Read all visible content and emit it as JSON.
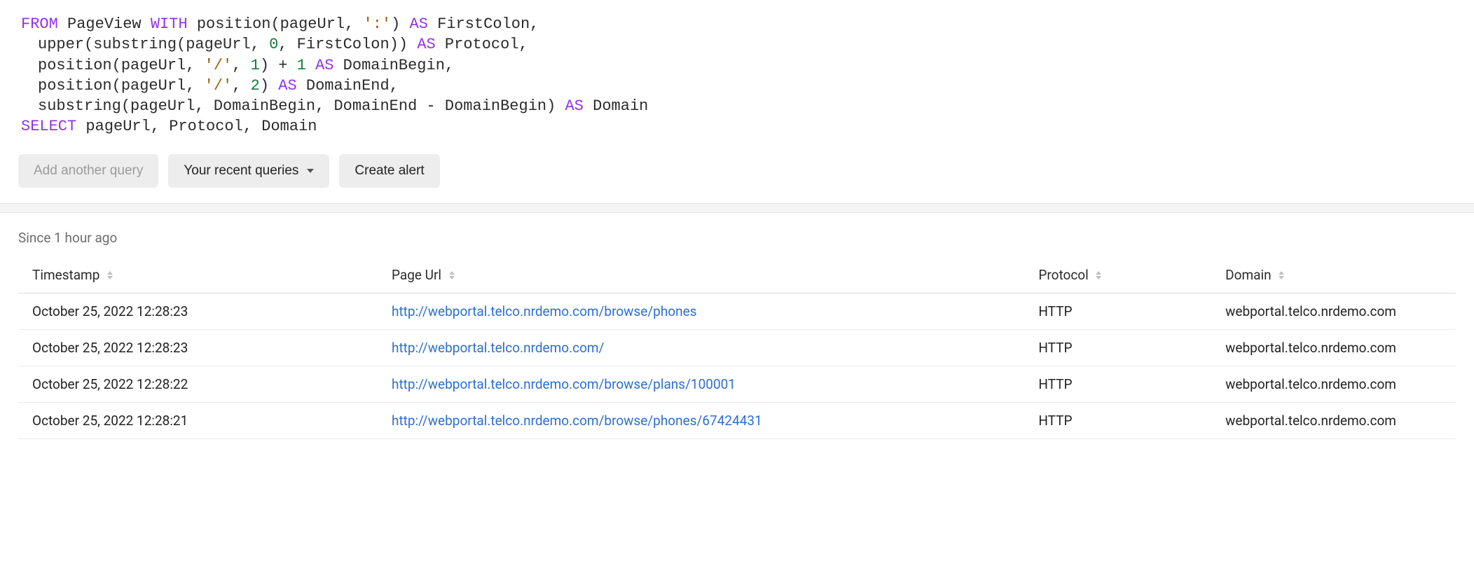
{
  "query": {
    "tokens": [
      [
        {
          "t": "FROM",
          "c": "kw"
        },
        {
          "t": " PageView ",
          "c": ""
        },
        {
          "t": "WITH",
          "c": "kw"
        },
        {
          "t": " position(pageUrl, ",
          "c": ""
        },
        {
          "t": "':'",
          "c": "str"
        },
        {
          "t": ") ",
          "c": ""
        },
        {
          "t": "AS",
          "c": "kw"
        },
        {
          "t": " FirstColon,",
          "c": ""
        }
      ],
      [
        {
          "t": "upper(substring(pageUrl, ",
          "c": ""
        },
        {
          "t": "0",
          "c": "num"
        },
        {
          "t": ", FirstColon)) ",
          "c": ""
        },
        {
          "t": "AS",
          "c": "kw"
        },
        {
          "t": " Protocol,",
          "c": ""
        }
      ],
      [
        {
          "t": "position(pageUrl, ",
          "c": ""
        },
        {
          "t": "'/'",
          "c": "str"
        },
        {
          "t": ", ",
          "c": ""
        },
        {
          "t": "1",
          "c": "num"
        },
        {
          "t": ") + ",
          "c": ""
        },
        {
          "t": "1",
          "c": "num"
        },
        {
          "t": " ",
          "c": ""
        },
        {
          "t": "AS",
          "c": "kw"
        },
        {
          "t": " DomainBegin,",
          "c": ""
        }
      ],
      [
        {
          "t": "position(pageUrl, ",
          "c": ""
        },
        {
          "t": "'/'",
          "c": "str"
        },
        {
          "t": ", ",
          "c": ""
        },
        {
          "t": "2",
          "c": "num"
        },
        {
          "t": ") ",
          "c": ""
        },
        {
          "t": "AS",
          "c": "kw"
        },
        {
          "t": " DomainEnd,",
          "c": ""
        }
      ],
      [
        {
          "t": "substring(pageUrl, DomainBegin, DomainEnd - DomainBegin) ",
          "c": ""
        },
        {
          "t": "AS",
          "c": "kw"
        },
        {
          "t": " Domain",
          "c": ""
        }
      ],
      [
        {
          "t": "SELECT",
          "c": "kw"
        },
        {
          "t": " pageUrl, Protocol, Domain",
          "c": ""
        }
      ]
    ],
    "indented": [
      false,
      true,
      true,
      true,
      true,
      false
    ]
  },
  "buttons": {
    "add_query": "Add another query",
    "recent_queries": "Your recent queries",
    "create_alert": "Create alert"
  },
  "since_label": "Since 1 hour ago",
  "table": {
    "columns": [
      "Timestamp",
      "Page Url",
      "Protocol",
      "Domain"
    ],
    "rows": [
      {
        "timestamp": "October 25, 2022 12:28:23",
        "page_url": "http://webportal.telco.nrdemo.com/browse/phones",
        "protocol": "HTTP",
        "domain": "webportal.telco.nrdemo.com"
      },
      {
        "timestamp": "October 25, 2022 12:28:23",
        "page_url": "http://webportal.telco.nrdemo.com/",
        "protocol": "HTTP",
        "domain": "webportal.telco.nrdemo.com"
      },
      {
        "timestamp": "October 25, 2022 12:28:22",
        "page_url": "http://webportal.telco.nrdemo.com/browse/plans/100001",
        "protocol": "HTTP",
        "domain": "webportal.telco.nrdemo.com"
      },
      {
        "timestamp": "October 25, 2022 12:28:21",
        "page_url": "http://webportal.telco.nrdemo.com/browse/phones/67424431",
        "protocol": "HTTP",
        "domain": "webportal.telco.nrdemo.com"
      }
    ]
  }
}
